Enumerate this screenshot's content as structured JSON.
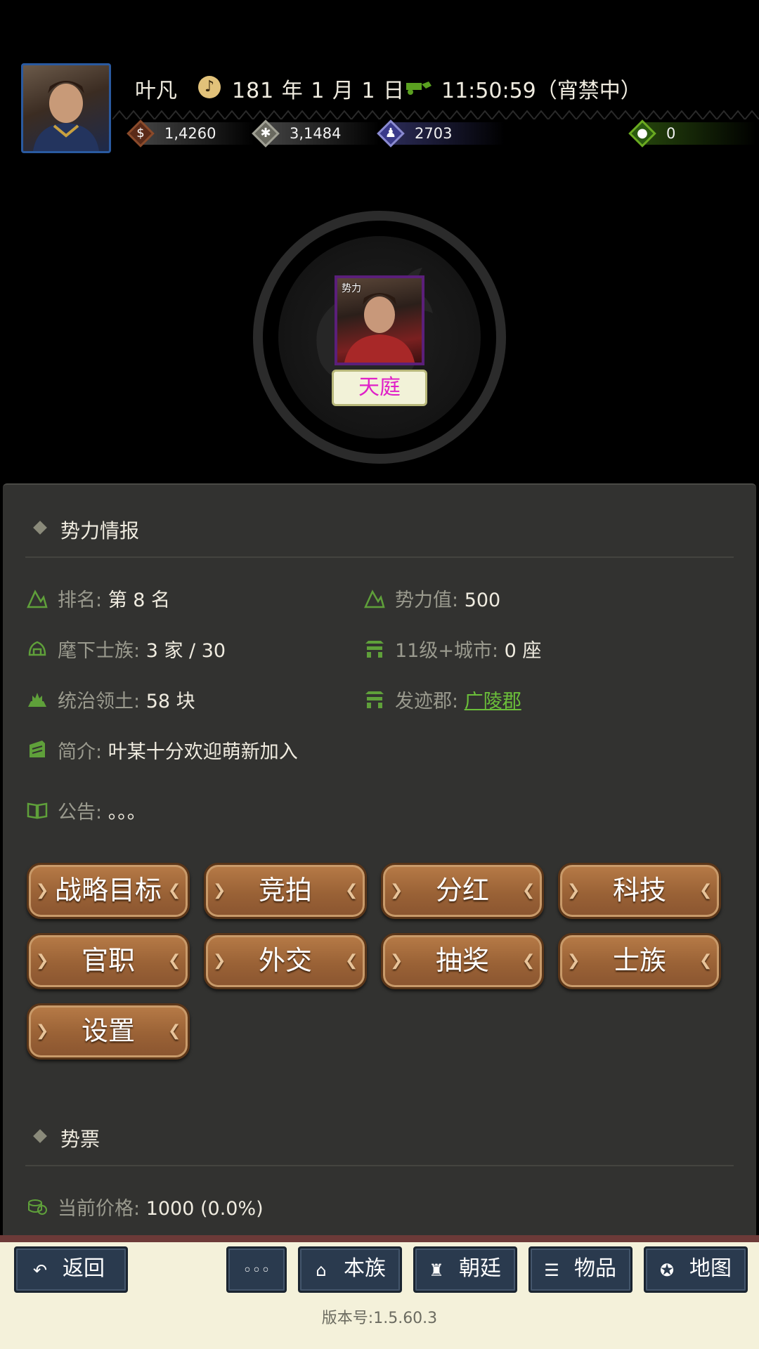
{
  "header": {
    "player_name": "叶凡",
    "date": "181 年 1 月 1 日",
    "time": "11:50:59（宵禁中）",
    "resources": [
      {
        "name": "coins",
        "icon": "coin-icon",
        "value": "1,4260",
        "color": "#7a3a22"
      },
      {
        "name": "grain",
        "icon": "grain-icon",
        "value": "3,1484",
        "color": "#9a9a8a"
      },
      {
        "name": "troops",
        "icon": "soldier-icon",
        "value": "2703",
        "color": "#5a5ab0"
      },
      {
        "name": "bag",
        "icon": "pouch-icon",
        "value": "0",
        "color": "#3a7a18"
      }
    ]
  },
  "faction": {
    "leader_tag": "势力",
    "name": "天庭"
  },
  "info_section": {
    "title": "势力情报",
    "rank_label": "排名:",
    "rank_value": "第 8 名",
    "power_label": "势力值:",
    "power_value": "500",
    "clans_label": "麾下士族:",
    "clans_value": "3 家 / 30",
    "cities_label": "11级+城市:",
    "cities_value": "0 座",
    "territory_label": "统治领土:",
    "territory_value": "58 块",
    "origin_label": "发迹郡:",
    "origin_value": "广陵郡",
    "intro_label": "简介:",
    "intro_value": "叶某十分欢迎萌新加入",
    "notice_label": "公告:",
    "notice_value": "。。。"
  },
  "actions": [
    {
      "label": "战略目标",
      "name": "strategy-goal-button"
    },
    {
      "label": "竞拍",
      "name": "auction-button"
    },
    {
      "label": "分红",
      "name": "dividend-button"
    },
    {
      "label": "科技",
      "name": "tech-button"
    },
    {
      "label": "官职",
      "name": "official-post-button"
    },
    {
      "label": "外交",
      "name": "diplomacy-button"
    },
    {
      "label": "抽奖",
      "name": "lottery-button"
    },
    {
      "label": "士族",
      "name": "clan-button"
    },
    {
      "label": "设置",
      "name": "settings-button"
    }
  ],
  "stock_section": {
    "title": "势票",
    "price_label": "当前价格:",
    "price_value": "1000 (0.0%)"
  },
  "nav": {
    "back": "返回",
    "more": "◦◦◦",
    "clan": "本族",
    "court": "朝廷",
    "items": "物品",
    "map": "地图"
  },
  "version": "版本号:1.5.60.3",
  "colors": {
    "panel_bg": "#323230",
    "button_brown": "#9a6236",
    "link_green": "#6bbf3a",
    "faction_name": "#e020c8",
    "nav_blue": "#2a3a4e"
  }
}
